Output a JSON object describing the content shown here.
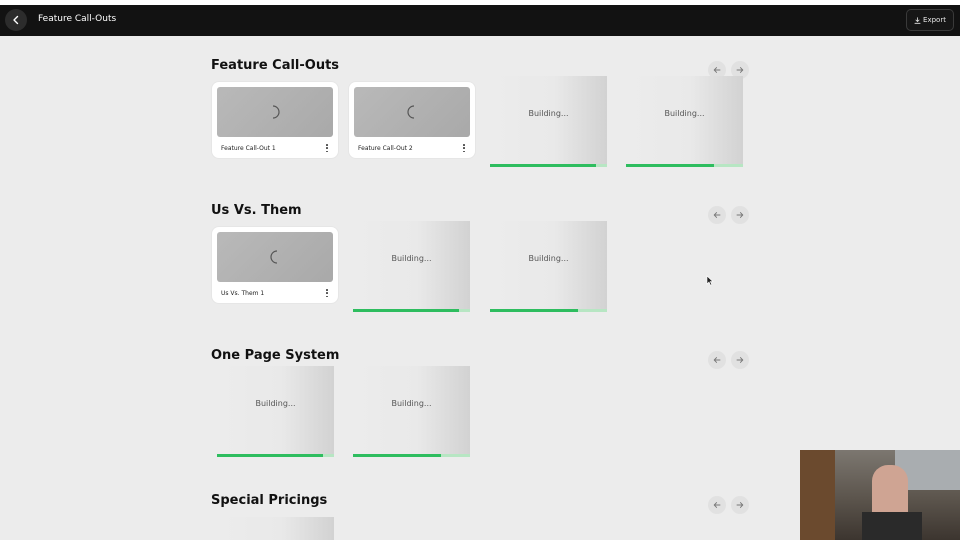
{
  "topbar": {
    "title": "Feature Call-Outs",
    "export_label": "Export"
  },
  "sections": [
    {
      "title": "Feature Call-Outs",
      "cards": [
        {
          "kind": "card",
          "label": "Feature Call-Out 1"
        },
        {
          "kind": "card",
          "label": "Feature Call-Out 2"
        },
        {
          "kind": "building",
          "label": "Building...",
          "progress": 0.91
        },
        {
          "kind": "building",
          "label": "Building...",
          "progress": 0.75
        }
      ]
    },
    {
      "title": "Us Vs. Them",
      "cards": [
        {
          "kind": "card",
          "label": "Us Vs. Them 1"
        },
        {
          "kind": "building",
          "label": "Building...",
          "progress": 0.91
        },
        {
          "kind": "building",
          "label": "Building...",
          "progress": 0.75
        }
      ]
    },
    {
      "title": "One Page System",
      "cards": [
        {
          "kind": "building",
          "label": "Building...",
          "progress": 0.91
        },
        {
          "kind": "building",
          "label": "Building...",
          "progress": 0.75
        }
      ]
    },
    {
      "title": "Special Pricings",
      "cards": [
        {
          "kind": "building",
          "label": "",
          "progress": 0.0
        }
      ]
    }
  ],
  "colors": {
    "topbar_bg": "#121212",
    "page_bg": "#ececec",
    "progress": "#2ebd5f"
  }
}
